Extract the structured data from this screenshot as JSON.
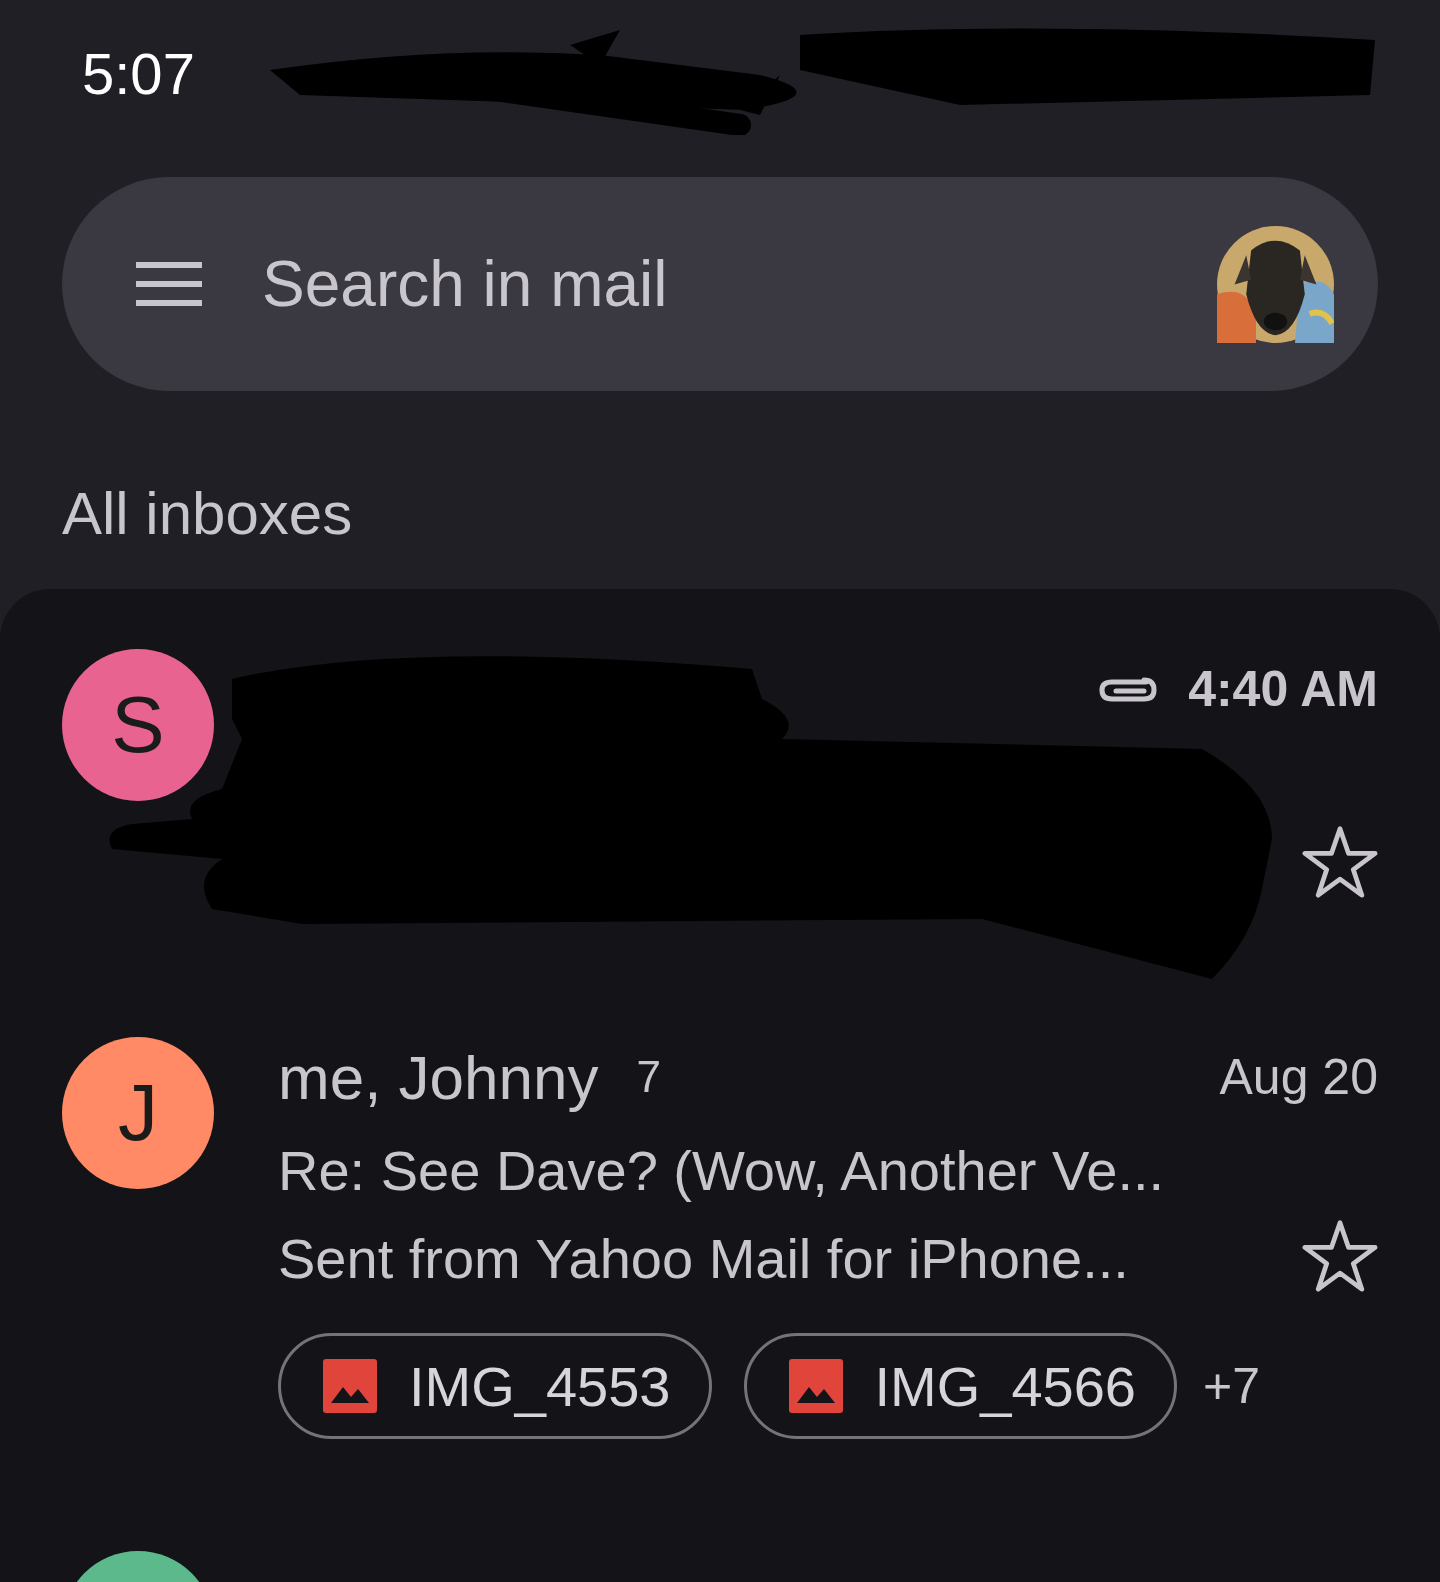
{
  "status_bar": {
    "time": "5:07",
    "redacted": true
  },
  "search": {
    "placeholder": "Search in mail"
  },
  "folder_title": "All inboxes",
  "emails": [
    {
      "avatar_letter": "S",
      "color": "#e8638f",
      "time": "4:40 AM",
      "unread": true,
      "has_attachment": true,
      "starred": false,
      "redacted": true
    },
    {
      "avatar_letter": "J",
      "color": "#ff8a65",
      "senders": "me, Johnny",
      "count": "7",
      "time": "Aug 20",
      "unread": false,
      "subject": "Re: See Dave? (Wow, Another Ve...",
      "snippet": "Sent from Yahoo Mail for iPhone...",
      "starred": false,
      "attachments": [
        {
          "name": "IMG_4553"
        },
        {
          "name": "IMG_4566"
        }
      ],
      "more_attachments": "+7"
    },
    {
      "color": "#5bb98c"
    }
  ]
}
